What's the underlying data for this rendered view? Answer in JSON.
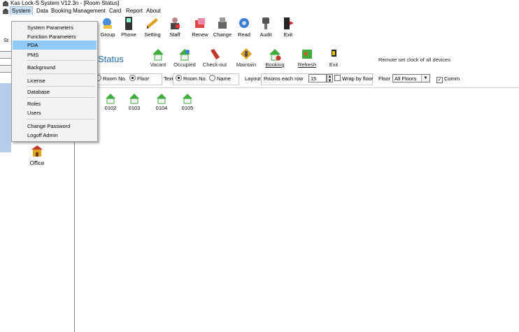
{
  "window": {
    "title": "Kas Lock-S System V12.3n - [Room Status]"
  },
  "menubar": {
    "items": [
      "System",
      "Data",
      "Booking Management",
      "Card",
      "Report",
      "About"
    ],
    "active": "System"
  },
  "toolbar": {
    "partial_label": "St",
    "buttons": [
      {
        "label": "Group",
        "icon": "group-icon"
      },
      {
        "label": "Phone",
        "icon": "phone-icon"
      },
      {
        "label": "Setting",
        "icon": "setting-icon"
      },
      {
        "label": "Staff",
        "icon": "staff-icon"
      },
      {
        "label": "Renew",
        "icon": "renew-icon"
      },
      {
        "label": "Change",
        "icon": "change-icon"
      },
      {
        "label": "Read",
        "icon": "read-icon"
      },
      {
        "label": "Audit",
        "icon": "audit-icon"
      },
      {
        "label": "Exit",
        "icon": "exit-icon"
      }
    ]
  },
  "system_menu": {
    "items": [
      {
        "label": "System Parameters"
      },
      {
        "label": "Function Parameters"
      },
      {
        "label": "PDA",
        "highlighted": true
      },
      {
        "label": "PMS"
      },
      {
        "label": "Background"
      },
      {
        "label": "License"
      },
      {
        "label": "Database"
      },
      {
        "label": "Roles"
      },
      {
        "label": "Users"
      },
      {
        "label": "Change Password"
      },
      {
        "label": "Logoff Admin"
      }
    ]
  },
  "left_pane": {
    "office_label": "Office"
  },
  "status_panel": {
    "title": "Status",
    "buttons": [
      {
        "label": "Vacant"
      },
      {
        "label": "Occupied"
      },
      {
        "label": "Check-out"
      },
      {
        "label": "Maintain"
      },
      {
        "label": "Booking"
      },
      {
        "label": "Refresh"
      },
      {
        "label": "Exit"
      }
    ],
    "remote_text": "Remote set clock of all devices"
  },
  "options": {
    "sort_room_no": "Room No.",
    "sort_floor": "Floor",
    "text_label": "Text",
    "text_room_no": "Room No.",
    "text_name": "Name",
    "layout_label": "Layout",
    "rooms_each_row_label": "Rooms each row",
    "rooms_each_row_value": "15",
    "wrap_by_floor": "Wrap by floor",
    "floor_label": "Floor",
    "floor_value": "All Floors",
    "comm_label": "Comm"
  },
  "rooms": [
    "0102",
    "0103",
    "0104",
    "0105"
  ],
  "colors": {
    "accent": "#1f6fb0",
    "menu_highlight": "#91c9f7",
    "room_roof": "#3fae3f"
  }
}
